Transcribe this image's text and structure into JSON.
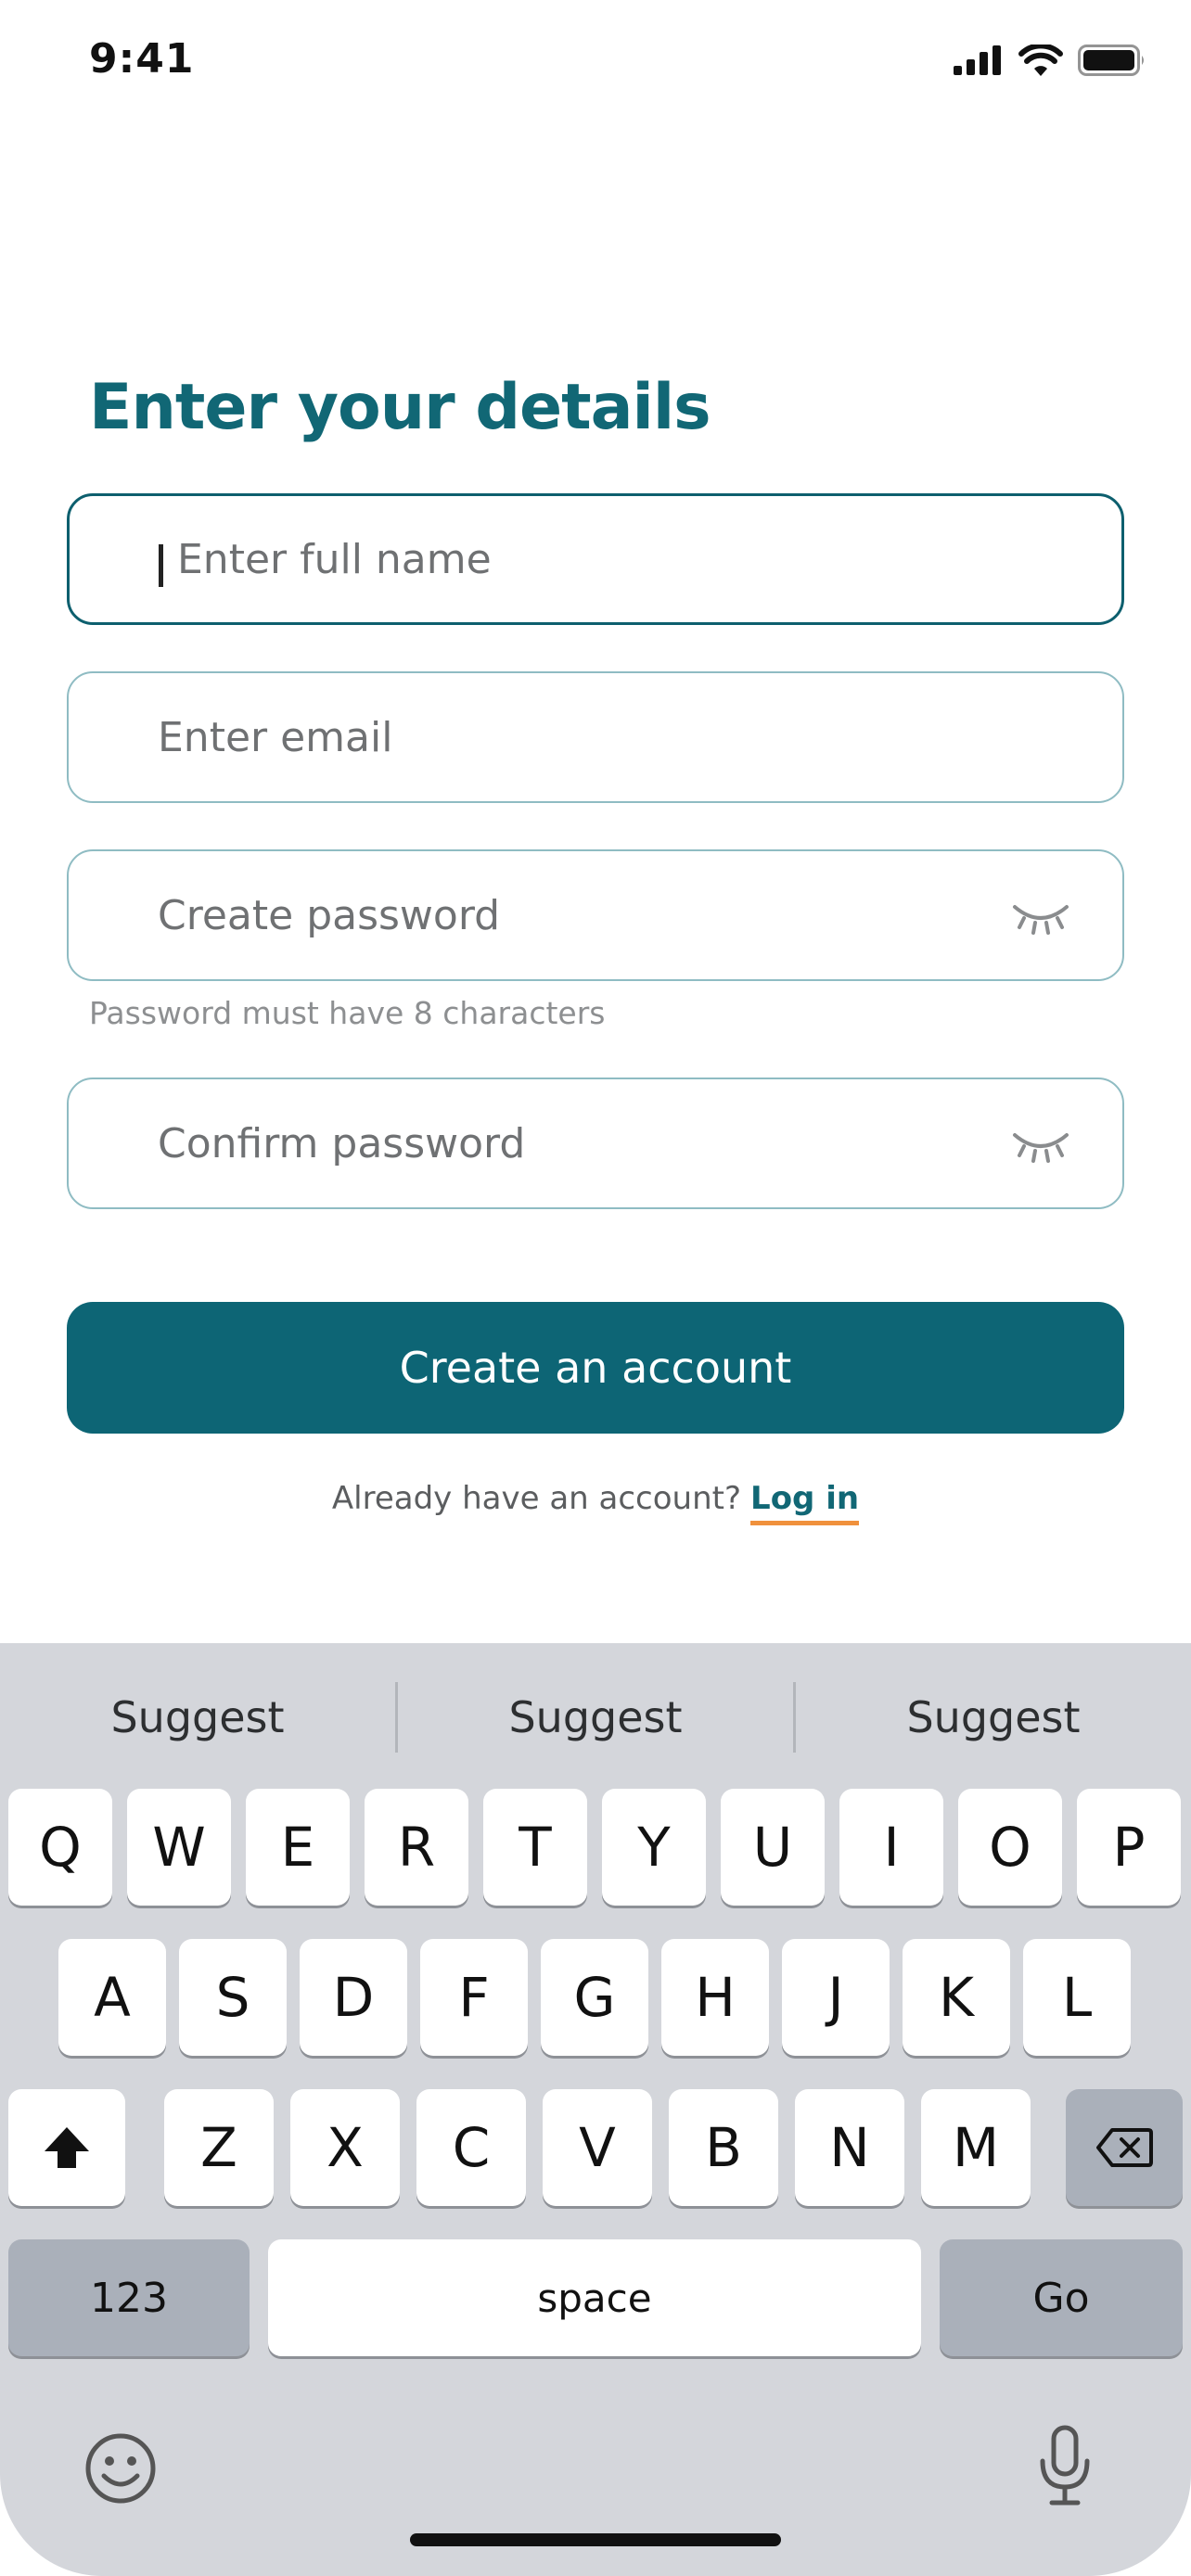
{
  "status_bar": {
    "time": "9:41",
    "icons": [
      "cellular-signal-icon",
      "wifi-icon",
      "battery-icon"
    ]
  },
  "form": {
    "title": "Enter your details",
    "full_name_placeholder": "Enter full name",
    "email_placeholder": "Enter email",
    "password_placeholder": "Create password",
    "password_hint": "Password must have 8 characters",
    "confirm_placeholder": "Confirm password",
    "submit_label": "Create an account",
    "login_prompt": "Already have an account?",
    "login_link": "Log in"
  },
  "keyboard": {
    "suggestions": [
      "Suggest",
      "Suggest",
      "Suggest"
    ],
    "row1": [
      "Q",
      "W",
      "E",
      "R",
      "T",
      "Y",
      "U",
      "I",
      "O",
      "P"
    ],
    "row2": [
      "A",
      "S",
      "D",
      "F",
      "G",
      "H",
      "J",
      "K",
      "L"
    ],
    "row3": [
      "Z",
      "X",
      "C",
      "V",
      "B",
      "N",
      "M"
    ],
    "numbers_label": "123",
    "space_label": "space",
    "go_label": "Go",
    "shift_icon": "shift-arrow-icon",
    "delete_icon": "backspace-icon",
    "emoji_icon": "emoji-face-icon",
    "mic_icon": "microphone-icon"
  },
  "colors": {
    "accent": "#116775",
    "button": "#0d6575",
    "field_border": "#8fbcc3",
    "link_underline": "#f0913c",
    "keyboard_bg": "#d4d6db"
  }
}
